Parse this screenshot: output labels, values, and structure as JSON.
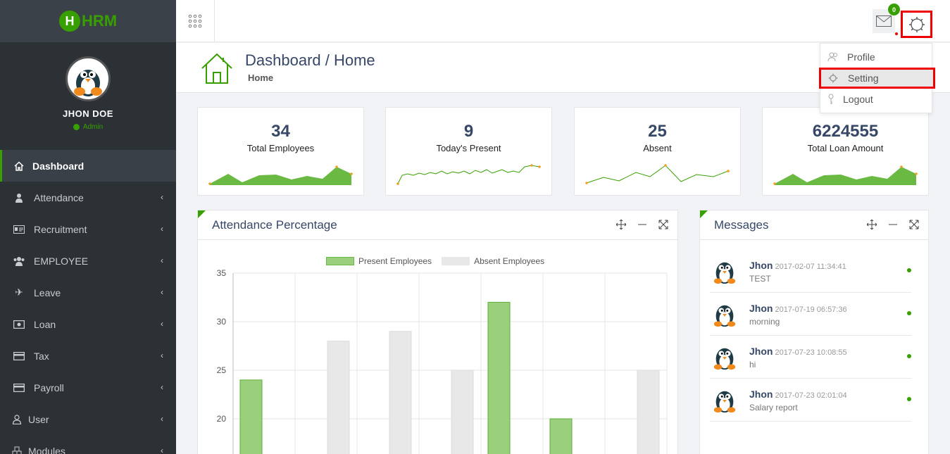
{
  "brand": {
    "logo_letter": "H",
    "logo_text": "HRM",
    "accent_color": "#37a000"
  },
  "user": {
    "name": "JHON DOE",
    "role": "Admin"
  },
  "sidebar": {
    "items": [
      {
        "label": "Dashboard",
        "icon": "home-icon"
      },
      {
        "label": "Attendance",
        "icon": "user-icon"
      },
      {
        "label": "Recruitment",
        "icon": "id-card-icon"
      },
      {
        "label": "EMPLOYEE",
        "icon": "users-icon"
      },
      {
        "label": "Leave",
        "icon": "plane-icon"
      },
      {
        "label": "Loan",
        "icon": "money-icon"
      },
      {
        "label": "Tax",
        "icon": "card-icon"
      },
      {
        "label": "Payroll",
        "icon": "card-icon"
      },
      {
        "label": "User",
        "icon": "user-outline-icon"
      },
      {
        "label": "Modules",
        "icon": "cubes-icon"
      }
    ]
  },
  "topbar": {
    "mail_count": "0"
  },
  "dropdown": {
    "items": [
      "Profile",
      "Setting",
      "Logout"
    ]
  },
  "page": {
    "title": "Dashboard / Home",
    "subtitle": "Home"
  },
  "stats": [
    {
      "value": "34",
      "label": "Total Employees"
    },
    {
      "value": "9",
      "label": "Today's Present"
    },
    {
      "value": "25",
      "label": "Absent"
    },
    {
      "value": "6224555",
      "label": "Total Loan Amount"
    }
  ],
  "attendance_panel": {
    "title": "Attendance Percentage"
  },
  "chart_data": {
    "type": "bar",
    "series": [
      {
        "name": "Present Employees",
        "color": "#9ad07b",
        "values": [
          24,
          null,
          null,
          null,
          32,
          20,
          null
        ]
      },
      {
        "name": "Absent Employees",
        "color": "#e8e8e8",
        "values": [
          null,
          28,
          29,
          25,
          null,
          null,
          25
        ]
      }
    ],
    "y_ticks": [
      35,
      30,
      25,
      20
    ],
    "ylim": [
      17,
      35
    ]
  },
  "messages_panel": {
    "title": "Messages",
    "items": [
      {
        "name": "Jhon",
        "time": "2017-02-07 11:34:41",
        "text": "TEST"
      },
      {
        "name": "Jhon",
        "time": "2017-07-19 06:57:36",
        "text": "morning"
      },
      {
        "name": "Jhon",
        "time": "2017-07-23 10:08:55",
        "text": "hi"
      },
      {
        "name": "Jhon",
        "time": "2017-07-23 02:01:04",
        "text": "Salary report"
      }
    ]
  }
}
